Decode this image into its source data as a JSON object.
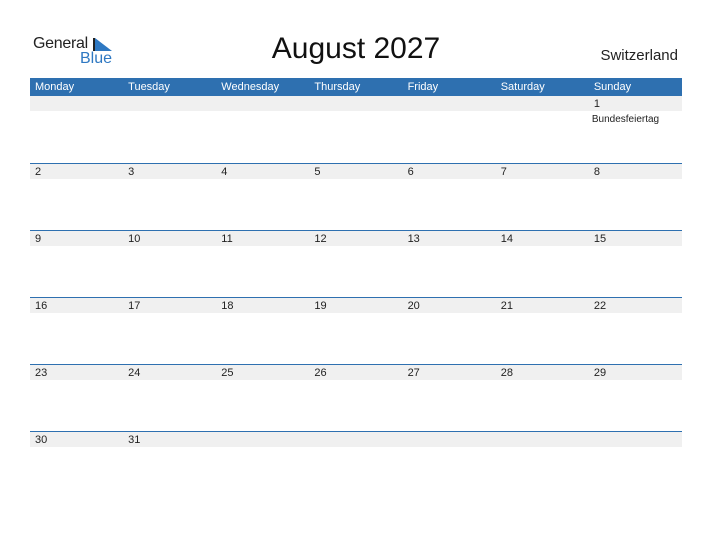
{
  "logo": {
    "general": "General",
    "blue": "Blue"
  },
  "title": "August 2027",
  "country": "Switzerland",
  "colors": {
    "accent": "#2e70b0",
    "band": "#f0f0f0"
  },
  "weekdays": [
    "Monday",
    "Tuesday",
    "Wednesday",
    "Thursday",
    "Friday",
    "Saturday",
    "Sunday"
  ],
  "weeks": [
    [
      {
        "day": ""
      },
      {
        "day": ""
      },
      {
        "day": ""
      },
      {
        "day": ""
      },
      {
        "day": ""
      },
      {
        "day": ""
      },
      {
        "day": "1",
        "event": "Bundesfeiertag"
      }
    ],
    [
      {
        "day": "2"
      },
      {
        "day": "3"
      },
      {
        "day": "4"
      },
      {
        "day": "5"
      },
      {
        "day": "6"
      },
      {
        "day": "7"
      },
      {
        "day": "8"
      }
    ],
    [
      {
        "day": "9"
      },
      {
        "day": "10"
      },
      {
        "day": "11"
      },
      {
        "day": "12"
      },
      {
        "day": "13"
      },
      {
        "day": "14"
      },
      {
        "day": "15"
      }
    ],
    [
      {
        "day": "16"
      },
      {
        "day": "17"
      },
      {
        "day": "18"
      },
      {
        "day": "19"
      },
      {
        "day": "20"
      },
      {
        "day": "21"
      },
      {
        "day": "22"
      }
    ],
    [
      {
        "day": "23"
      },
      {
        "day": "24"
      },
      {
        "day": "25"
      },
      {
        "day": "26"
      },
      {
        "day": "27"
      },
      {
        "day": "28"
      },
      {
        "day": "29"
      }
    ],
    [
      {
        "day": "30"
      },
      {
        "day": "31"
      },
      {
        "day": ""
      },
      {
        "day": ""
      },
      {
        "day": ""
      },
      {
        "day": ""
      },
      {
        "day": ""
      }
    ]
  ]
}
